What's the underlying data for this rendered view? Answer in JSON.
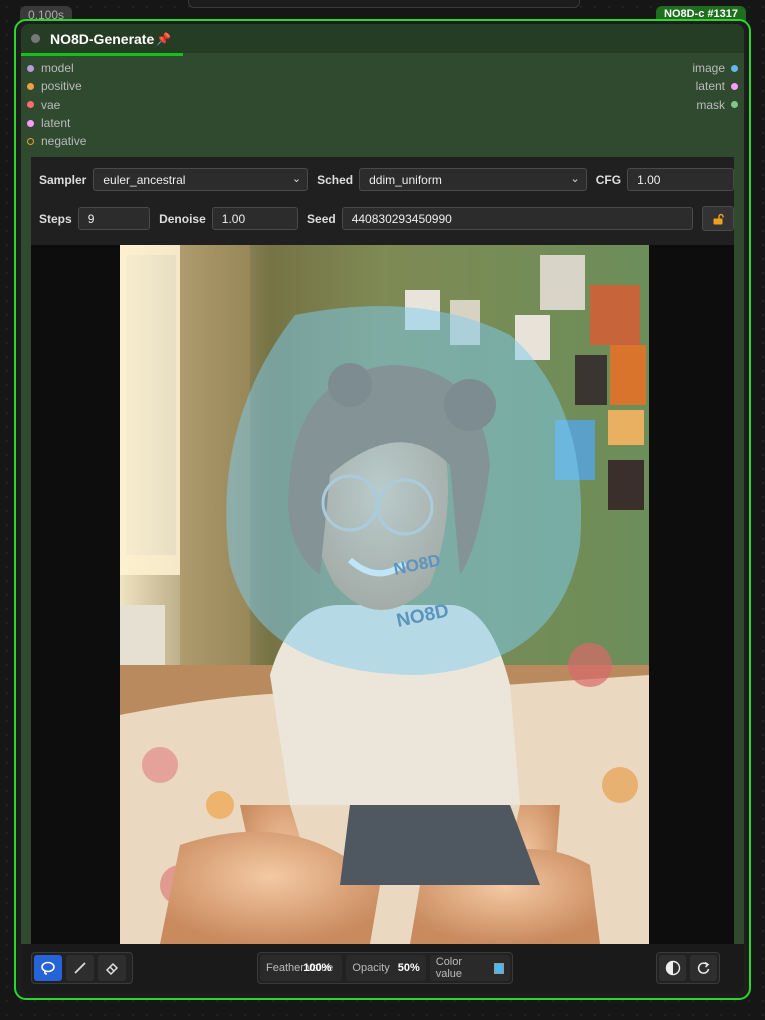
{
  "timing": "0.100s",
  "node_id": "NO8D-c  #1317",
  "node": {
    "title": "NO8D-Generate",
    "pin_icon": "pushpin-icon",
    "inputs": [
      {
        "label": "model",
        "color": "#b39ddb"
      },
      {
        "label": "positive",
        "color": "#f0a040"
      },
      {
        "label": "vae",
        "color": "#ff6e6e"
      },
      {
        "label": "latent",
        "color": "#ff9cf9"
      },
      {
        "label": "negative",
        "color": "#f0a040"
      }
    ],
    "outputs": [
      {
        "label": "image",
        "color": "#64b5f6"
      },
      {
        "label": "latent",
        "color": "#ff9cf9"
      },
      {
        "label": "mask",
        "color": "#81c784"
      }
    ]
  },
  "widgets": {
    "sampler_label": "Sampler",
    "sampler_value": "euler_ancestral",
    "sched_label": "Sched",
    "sched_value": "ddim_uniform",
    "cfg_label": "CFG",
    "cfg_value": "1.00",
    "steps_label": "Steps",
    "steps_value": "9",
    "denoise_label": "Denoise",
    "denoise_value": "1.00",
    "seed_label": "Seed",
    "seed_value": "440830293450990",
    "lock_icon": "unlock-icon"
  },
  "image": {
    "face_text": "NO8D",
    "neck_text": "NO8D",
    "mask_color": "#7ecdf2"
  },
  "mask_toolbar": {
    "tools": [
      "lasso-icon",
      "brush-icon",
      "eraser-icon"
    ],
    "active_tool": "lasso-icon",
    "feather_label": "Feather value",
    "feather_value": "100%",
    "opacity_label": "Opacity",
    "opacity_value": "50%",
    "color_label": "Color value",
    "color_swatch": "#4cb8f0",
    "actions": [
      "invert-icon",
      "reset-icon"
    ]
  }
}
